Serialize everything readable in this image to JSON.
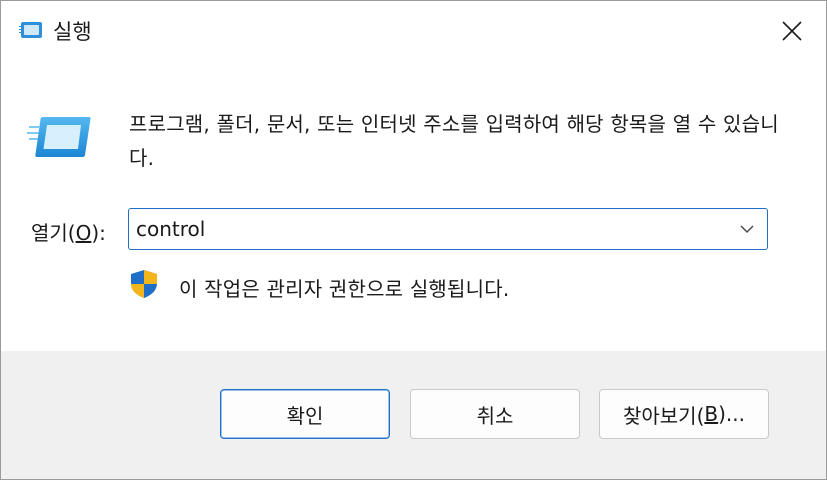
{
  "window": {
    "title": "실행",
    "close_glyph": "✕"
  },
  "dialog": {
    "description": "프로그램, 폴더, 문서, 또는 인터넷 주소를 입력하여 해당 항목을 열 수 있습니다.",
    "open_label_prefix": "열기(",
    "open_label_mnemonic": "O",
    "open_label_suffix": "):",
    "open_value": "control",
    "admin_note": "이 작업은 관리자 권한으로 실행됩니다."
  },
  "buttons": {
    "ok_label": "확인",
    "cancel_label": "취소",
    "browse_prefix": "찾아보기(",
    "browse_mnemonic": "B",
    "browse_suffix": ")..."
  },
  "colors": {
    "accent": "#1f6fc8",
    "footer_bg": "#f0f0f0"
  },
  "icons": {
    "title": "run-dialog-icon",
    "run": "run-dialog-icon",
    "close": "close-icon",
    "dropdown": "chevron-down-icon",
    "uac": "uac-shield-icon"
  }
}
